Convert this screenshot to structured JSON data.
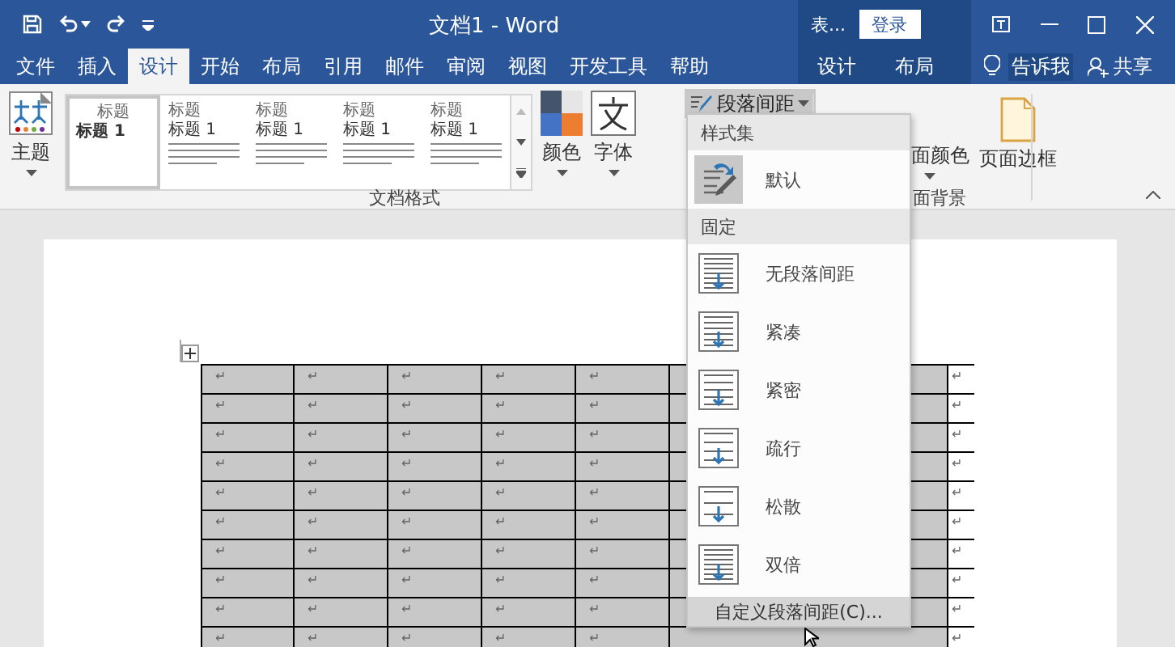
{
  "window": {
    "title": "文档1 - Word",
    "context_label": "表...",
    "sign_in": "登录"
  },
  "tabs": [
    {
      "label": "文件",
      "selected": false
    },
    {
      "label": "插入",
      "selected": false
    },
    {
      "label": "设计",
      "selected": true
    },
    {
      "label": "开始",
      "selected": false
    },
    {
      "label": "布局",
      "selected": false
    },
    {
      "label": "引用",
      "selected": false
    },
    {
      "label": "邮件",
      "selected": false
    },
    {
      "label": "审阅",
      "selected": false
    },
    {
      "label": "视图",
      "selected": false
    },
    {
      "label": "开发工具",
      "selected": false
    },
    {
      "label": "帮助",
      "selected": false
    }
  ],
  "context_tabs": [
    {
      "label": "设计",
      "selected": false
    },
    {
      "label": "布局",
      "selected": false
    }
  ],
  "tell_me": "告诉我",
  "share": "共享",
  "ribbon": {
    "theme_button": "主题",
    "gallery": [
      {
        "title": "标题",
        "heading": "标题 1",
        "selected": true
      },
      {
        "title": "标题",
        "heading": "标题 1",
        "selected": false
      },
      {
        "title": "标题",
        "heading": "标题 1",
        "selected": false
      },
      {
        "title": "标题",
        "heading": "标题 1",
        "selected": false
      },
      {
        "title": "标题",
        "heading": "标题 1",
        "selected": false
      }
    ],
    "colors_button": "颜色",
    "fonts_button": "字体",
    "spacing_button": "段落间距",
    "group_label": "文档格式",
    "page_color_button": "面颜色",
    "page_borders_button": "页面边框",
    "background_group_label": "面背景"
  },
  "menu": [
    {
      "kind": "header",
      "label": "样式集"
    },
    {
      "kind": "item",
      "label": "默认",
      "selected": true
    },
    {
      "kind": "header",
      "label": "固定"
    },
    {
      "kind": "item",
      "label": "无段落间距",
      "selected": false
    },
    {
      "kind": "item",
      "label": "紧凑",
      "selected": false
    },
    {
      "kind": "item",
      "label": "紧密",
      "selected": false
    },
    {
      "kind": "item",
      "label": "疏行",
      "selected": false
    },
    {
      "kind": "item",
      "label": "松散",
      "selected": false
    },
    {
      "kind": "item",
      "label": "双倍",
      "selected": false
    },
    {
      "kind": "command",
      "label": "自定义段落间距(C)...",
      "highlighted": true
    }
  ],
  "table": {
    "rows": [
      {
        "cells": [
          "↵",
          "↵",
          "↵",
          "↵",
          "↵"
        ],
        "end": "↵"
      },
      {
        "cells": [
          "↵",
          "↵",
          "↵",
          "↵",
          "↵"
        ],
        "end": "↵"
      },
      {
        "cells": [
          "↵",
          "↵",
          "↵",
          "↵",
          "↵"
        ],
        "end": "↵"
      },
      {
        "cells": [
          "↵",
          "↵",
          "↵",
          "↵",
          "↵"
        ],
        "end": "↵"
      },
      {
        "cells": [
          "↵",
          "↵",
          "↵",
          "↵",
          "↵"
        ],
        "end": "↵"
      },
      {
        "cells": [
          "↵",
          "↵",
          "↵",
          "↵",
          "↵"
        ],
        "end": "↵"
      },
      {
        "cells": [
          "↵",
          "↵",
          "↵",
          "↵",
          "↵"
        ],
        "end": "↵"
      },
      {
        "cells": [
          "↵",
          "↵",
          "↵",
          "↵",
          "↵"
        ],
        "end": "↵"
      },
      {
        "cells": [
          "↵",
          "↵",
          "↵",
          "↵",
          "↵"
        ],
        "end": "↵"
      },
      {
        "cells": [
          "↵",
          "↵",
          "↵",
          "↵",
          "↵"
        ],
        "end": "↵"
      }
    ]
  }
}
